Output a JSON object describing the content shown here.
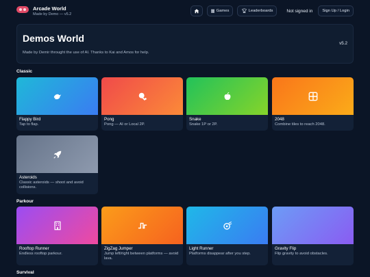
{
  "header": {
    "app_title": "Arcade World",
    "app_subtitle": "Made by Demo — v5.2",
    "nav": {
      "home_icon": "home-icon",
      "games_label": "Games",
      "leaderboards_label": "Leaderboards",
      "signed_status": "Not signed in",
      "signup_label": "Sign Up / Login"
    }
  },
  "hero": {
    "title": "Demos World",
    "description": "Made by Demir throught the use of AI. Thanks to Kai and Amos for help.",
    "version": "v5.2"
  },
  "sections": [
    {
      "title": "Classic",
      "cards": [
        {
          "title": "Flappy Bird",
          "desc": "Tap to flap.",
          "icon": "bird-icon"
        },
        {
          "title": "Pong",
          "desc": "Pong — AI or Local 2P.",
          "icon": "ping-pong-icon"
        },
        {
          "title": "Snake",
          "desc": "Snake 1P or 2P.",
          "icon": "apple-icon"
        },
        {
          "title": "2048",
          "desc": "Combine tiles to reach 2048.",
          "icon": "grid-icon"
        },
        {
          "title": "Asteroids",
          "desc": "Classic asteroids — shoot and avoid collisions.",
          "icon": "rocket-icon"
        }
      ]
    },
    {
      "title": "Parkour",
      "cards": [
        {
          "title": "Rooftop Runner",
          "desc": "Endless rooftop parkour.",
          "icon": "building-icon"
        },
        {
          "title": "ZigZag Jumper",
          "desc": "Jump left/right between platforms — avoid lava.",
          "icon": "zigzag-icon"
        },
        {
          "title": "Light Runner",
          "desc": "Platforms disappear after you step.",
          "icon": "comet-icon"
        },
        {
          "title": "Gravity Flip",
          "desc": "Flip gravity to avoid obstacles.",
          "icon": "none"
        }
      ]
    },
    {
      "title": "Survival",
      "cards": []
    }
  ],
  "colors": {
    "background": "#0b1526",
    "flappy": [
      "#1fb8d8",
      "#3a7cf2"
    ],
    "pong": [
      "#f04a4a",
      "#fb8a38"
    ],
    "snake": [
      "#22c25a",
      "#86d42a"
    ],
    "g2048": [
      "#f9761a",
      "#fbab19"
    ],
    "asteroids": [
      "#66748a",
      "#8e9aae"
    ],
    "rooftop": [
      "#9b4cf2",
      "#ef4aa0"
    ],
    "zigzag": [
      "#fb9c1a",
      "#f6621f"
    ],
    "light": [
      "#1fb8e8",
      "#3a7cf2"
    ],
    "gravity": [
      "#6c9cf6",
      "#8a5cf2"
    ]
  }
}
